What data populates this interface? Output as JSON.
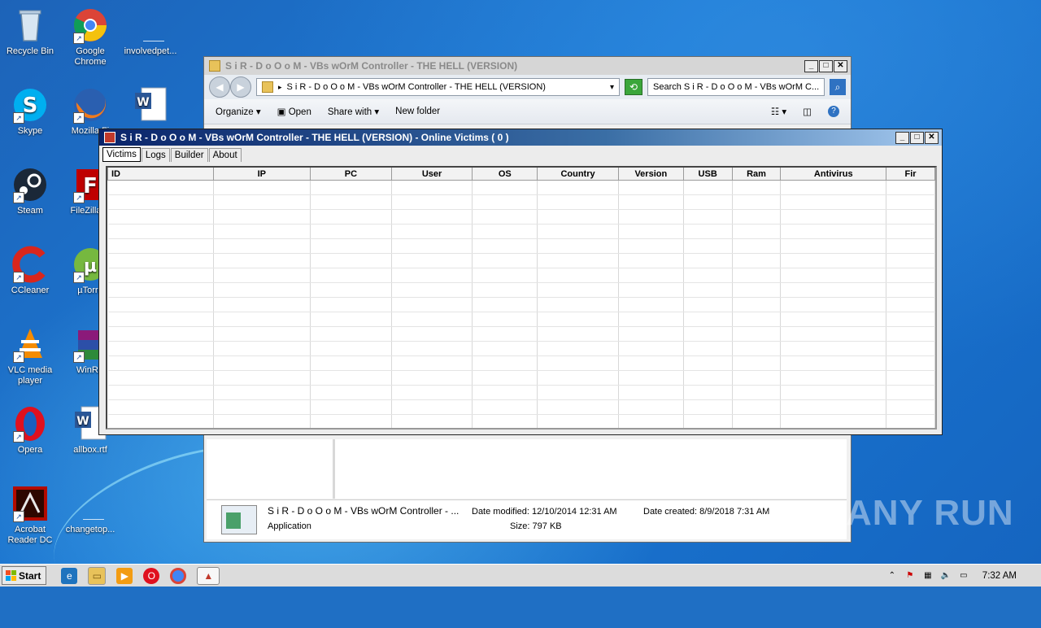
{
  "desktop": {
    "icons": [
      {
        "label": "Recycle Bin",
        "icon": "recycle-bin-icon"
      },
      {
        "label": "Google Chrome",
        "icon": "chrome-icon"
      },
      {
        "label": "involvedpet...",
        "icon": "blank-file-icon"
      },
      {
        "label": "Skype",
        "icon": "skype-icon"
      },
      {
        "label": "Mozilla Fi",
        "icon": "firefox-icon"
      },
      {
        "label": "",
        "icon": "word-doc-icon"
      },
      {
        "label": "Steam",
        "icon": "steam-icon"
      },
      {
        "label": "FileZilla C",
        "icon": "filezilla-icon"
      },
      {
        "label": "CCleaner",
        "icon": "ccleaner-icon"
      },
      {
        "label": "µTorre",
        "icon": "utorrent-icon"
      },
      {
        "label": "VLC media player",
        "icon": "vlc-icon"
      },
      {
        "label": "WinRA",
        "icon": "winrar-icon"
      },
      {
        "label": "Opera",
        "icon": "opera-icon"
      },
      {
        "label": "allbox.rtf",
        "icon": "word-doc-icon"
      },
      {
        "label": "Acrobat Reader DC",
        "icon": "acrobat-icon"
      },
      {
        "label": "changetop...",
        "icon": "blank-file-icon"
      }
    ]
  },
  "explorer": {
    "title": "S i R - D o O o M  - VBs wOrM Controller - THE HELL (VERSION)",
    "address": "S i R - D o O o M  - VBs wOrM Controller - THE HELL (VERSION)",
    "search_placeholder": "Search S i R - D o O o M  - VBs wOrM C...",
    "commands": {
      "organize": "Organize",
      "open": "Open",
      "share_with": "Share with",
      "new_folder": "New folder"
    },
    "details": {
      "name": "S i R - D o O o M  - VBs wOrM Controller - ...",
      "type": "Application",
      "date_modified_label": "Date modified:",
      "date_modified": "12/10/2014 12:31 AM",
      "date_created_label": "Date created:",
      "date_created": "8/9/2018 7:31 AM",
      "size_label": "Size:",
      "size": "797 KB"
    }
  },
  "controller": {
    "title": "S i R - D o O o M  - VBs wOrM Controller - THE HELL (VERSION) - Online Victims ( 0 )",
    "tabs": [
      "Victims",
      "Logs",
      "Builder",
      "About"
    ],
    "columns": [
      "ID",
      "IP",
      "PC",
      "User",
      "OS",
      "Country",
      "Version",
      "USB",
      "Ram",
      "Antivirus",
      "Fir"
    ],
    "rows": []
  },
  "taskbar": {
    "start_label": "Start",
    "clock": "7:32 AM",
    "pinned": [
      "ie-icon",
      "explorer-icon",
      "media-player-icon",
      "opera-icon",
      "chrome-icon",
      "worm-controller-icon"
    ]
  },
  "watermark": "ANY RUN"
}
